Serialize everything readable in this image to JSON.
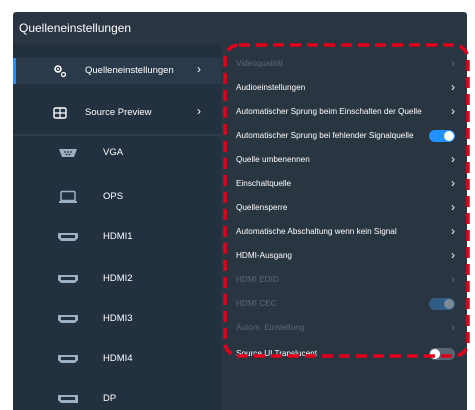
{
  "title": "Quelleneinstellungen",
  "nav": [
    {
      "label": "Quelleneinstellungen",
      "icon": "gear-icon",
      "chevron": "›"
    },
    {
      "label": "Source Preview",
      "icon": "source-preview-icon",
      "chevron": "›"
    }
  ],
  "sources": [
    {
      "label": "VGA",
      "icon": "vga-port-icon"
    },
    {
      "label": "OPS",
      "icon": "ops-computer-icon"
    },
    {
      "label": "HDMI1",
      "icon": "hdmi-port-icon"
    },
    {
      "label": "HDMI2",
      "icon": "hdmi-port-icon"
    },
    {
      "label": "HDMI3",
      "icon": "hdmi-port-icon"
    },
    {
      "label": "HDMI4",
      "icon": "hdmi-port-icon"
    },
    {
      "label": "DP",
      "icon": "displayport-icon"
    }
  ],
  "settings": [
    {
      "label": "Videoqualität",
      "control": "chevron",
      "chevron": "›",
      "enabled": false
    },
    {
      "label": "Audioeinstellungen",
      "control": "chevron",
      "chevron": "›",
      "enabled": true
    },
    {
      "label": "Automatischer Sprung beim Einschalten der Quelle",
      "control": "chevron",
      "chevron": "›",
      "enabled": true
    },
    {
      "label": "Automatischer Sprung bei fehlender Signalquelle",
      "control": "toggle",
      "state": "on",
      "enabled": true
    },
    {
      "label": "Quelle umbenennen",
      "control": "chevron",
      "chevron": "›",
      "enabled": true
    },
    {
      "label": "Einschaltquelle",
      "control": "chevron",
      "chevron": "›",
      "enabled": true
    },
    {
      "label": "Quellensperre",
      "control": "chevron",
      "chevron": "›",
      "enabled": true
    },
    {
      "label": "Automatische Abschaltung wenn kein Signal",
      "control": "chevron",
      "chevron": "›",
      "enabled": true
    },
    {
      "label": "HDMI-Ausgang",
      "control": "chevron",
      "chevron": "›",
      "enabled": true
    },
    {
      "label": "HDMI EDID",
      "control": "chevron",
      "chevron": "›",
      "enabled": false
    },
    {
      "label": "HDMI CEC",
      "control": "toggle",
      "state": "on",
      "enabled": false
    },
    {
      "label": "Autom. Einstellung",
      "control": "chevron",
      "chevron": "›",
      "enabled": false
    },
    {
      "label": "Source UI Translucent",
      "control": "toggle",
      "state": "off",
      "enabled": true
    }
  ],
  "colors": {
    "panel_bg": "#2a3542",
    "sidebar_bg": "#233040",
    "accent": "#1e90ff",
    "highlight_dash": "#e3001b"
  }
}
